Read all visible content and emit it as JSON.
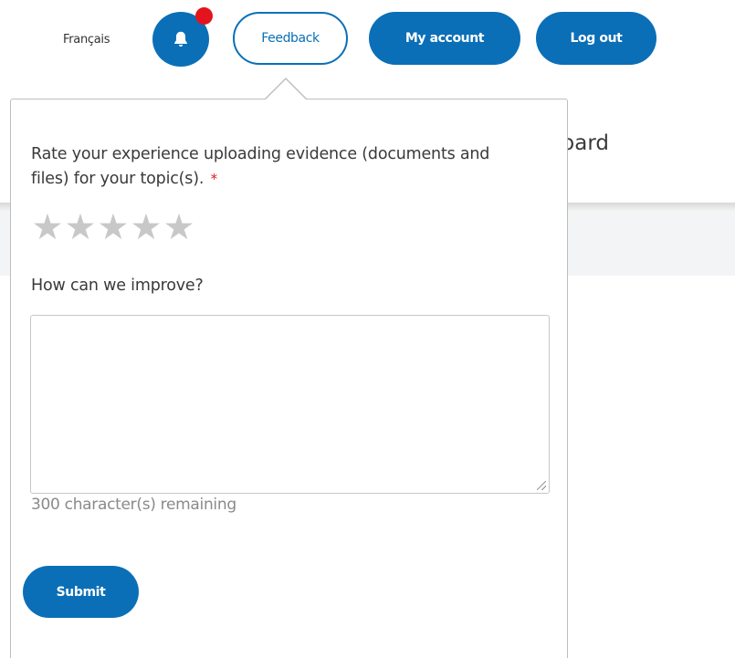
{
  "header": {
    "language_link": "Français",
    "feedback_label": "Feedback",
    "account_label": "My account",
    "logout_label": "Log out",
    "notification_icon": "bell-icon",
    "notification_dot_color": "#e3141d"
  },
  "page": {
    "heading_partial": "nboard"
  },
  "feedback": {
    "rating_question": "Rate your experience uploading evidence (documents and files) for your topic(s).",
    "required_marker": "*",
    "stars": [
      "★",
      "★",
      "★",
      "★",
      "★"
    ],
    "rating_value": 0,
    "rating_max": 5,
    "improve_question": "How can we improve?",
    "comment_value": "",
    "remaining_text": "300 character(s) remaining",
    "submit_label": "Submit"
  },
  "colors": {
    "primary": "#0a6fb7",
    "required": "#e3141d",
    "star_empty": "#c8c8c8"
  }
}
